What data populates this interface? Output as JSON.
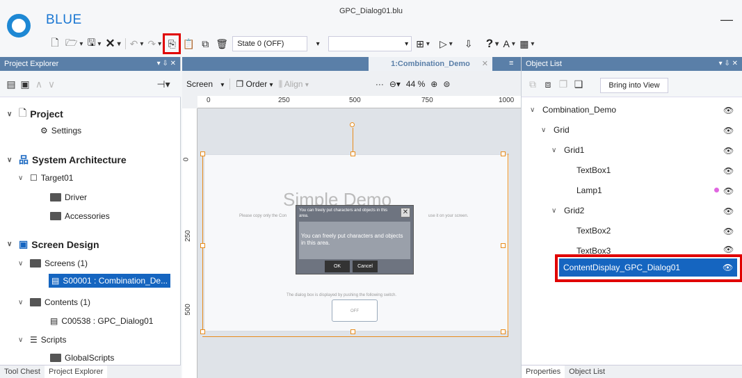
{
  "app": {
    "name": "BLUE",
    "window_title": "GPC_Dialog01.blu",
    "minimize_label": "—"
  },
  "toolbar": {
    "state_value": "State 0 (OFF)"
  },
  "project_explorer": {
    "title": "Project Explorer",
    "header_controls": "▾ ⇩ ✕",
    "project_label": "Project",
    "settings_label": "Settings",
    "system_architecture_label": "System Architecture",
    "target_label": "Target01",
    "driver_label": "Driver",
    "accessories_label": "Accessories",
    "screen_design_label": "Screen Design",
    "screens_label": "Screens (1)",
    "screen_item_label": "S00001 : Combination_De...",
    "contents_label": "Contents (1)",
    "content_item_label": "C00538 : GPC_Dialog01",
    "scripts_label": "Scripts",
    "global_scripts_label": "GlobalScripts",
    "tabs": [
      "Tool Chest",
      "Project Explorer"
    ]
  },
  "editor": {
    "tab_label": "1:Combination_Demo",
    "screen_label": "Screen",
    "order_label": "Order",
    "align_label": "Align",
    "zoom_label": "44 %",
    "ruler_top": [
      "0",
      "250",
      "500",
      "750",
      "1000"
    ],
    "ruler_left": [
      "0",
      "250",
      "500"
    ],
    "canvas": {
      "title": "Simple Demo",
      "copy_text": "Please copy only the Con",
      "copy_text_tail": "use it on your screen.",
      "push_text": "The dialog box is displayed by pushing the following switch.",
      "off_label": "OFF",
      "dialog_title": "You can freely put characters and objects in this area.",
      "dialog_body": "You can freely put characters and objects in this area.",
      "ok_label": "OK",
      "cancel_label": "Cancel"
    }
  },
  "object_list": {
    "title": "Object List",
    "bring_into_view_label": "Bring into View",
    "items": {
      "combination_demo": "Combination_Demo",
      "grid": "Grid",
      "grid1": "Grid1",
      "textbox1": "TextBox1",
      "lamp1": "Lamp1",
      "grid2": "Grid2",
      "textbox2": "TextBox2",
      "textbox3": "TextBox3",
      "content_display": "ContentDisplay_GPC_Dialog01"
    },
    "lamp_dot_color": "#e066e0",
    "tabs": [
      "Properties",
      "Object List"
    ]
  },
  "colors": {
    "accent": "#1565c0",
    "panel_header": "#5a7fa8",
    "highlight": "#e00000",
    "selection_outline": "#e88b1a"
  }
}
